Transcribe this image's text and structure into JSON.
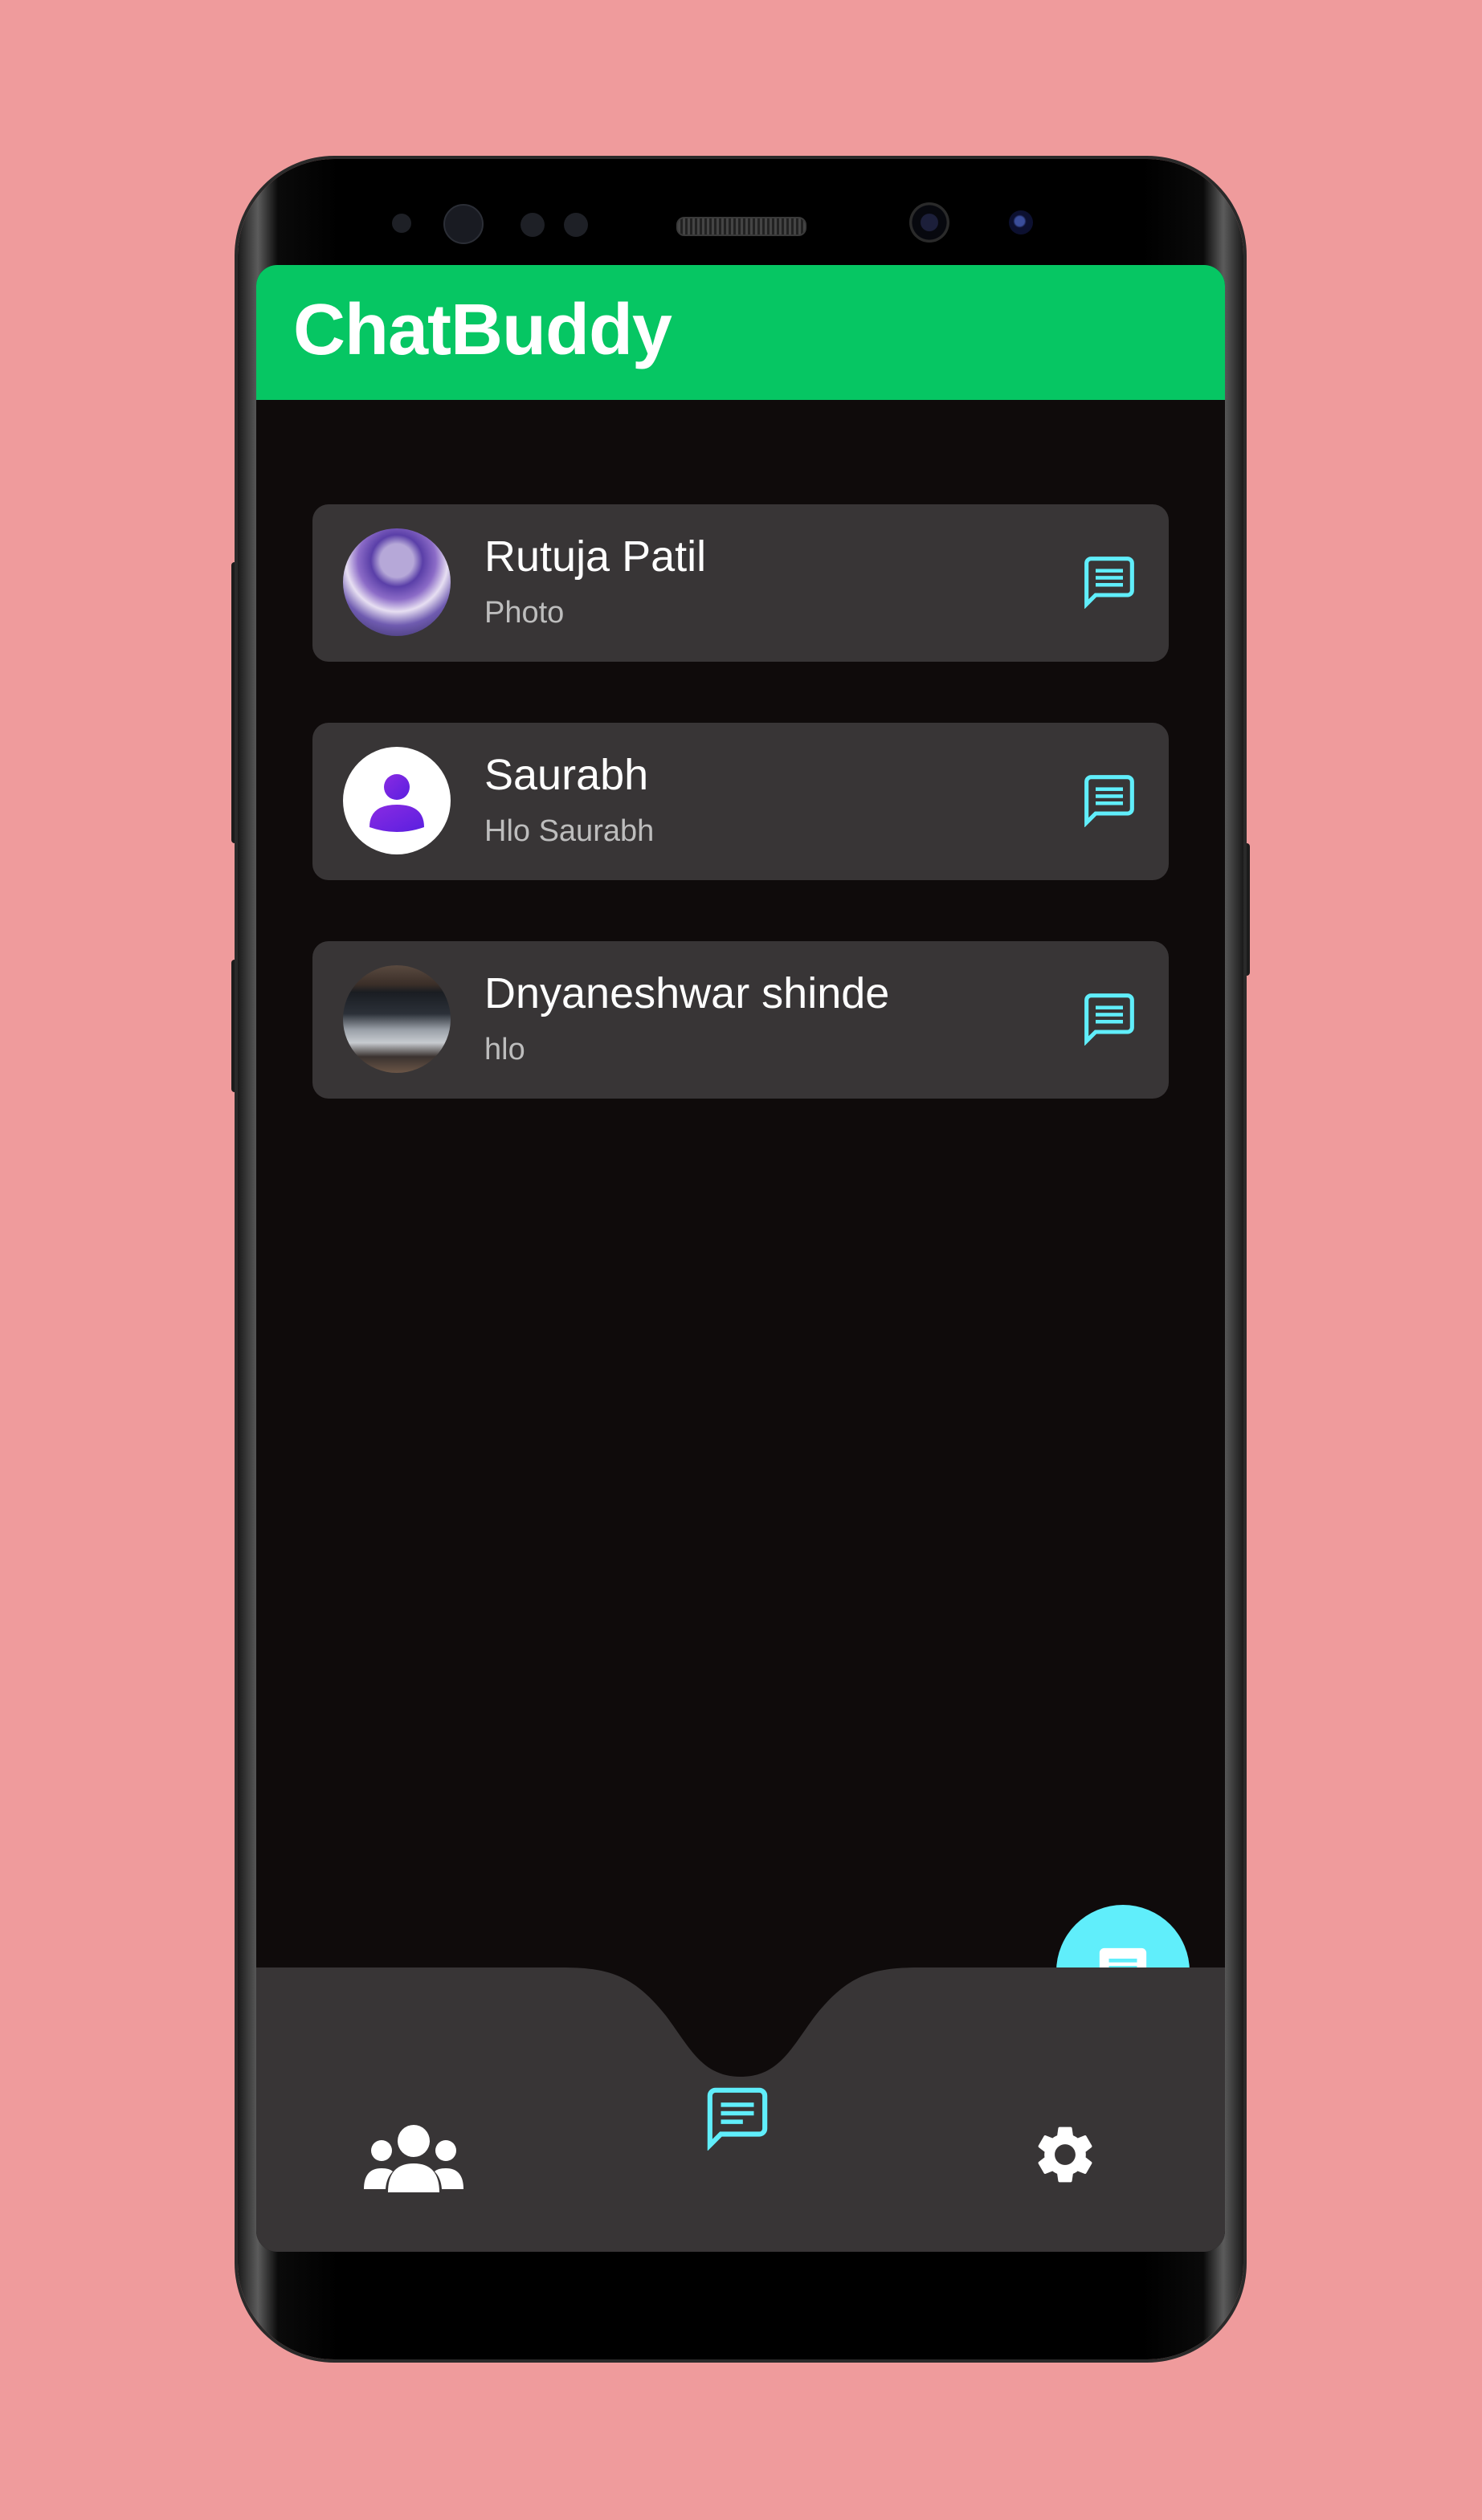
{
  "app": {
    "title": "ChatBuddy",
    "accent_color": "#06C663",
    "icon_color": "#60EEFB"
  },
  "chats": [
    {
      "name": "Rutuja Patil",
      "last_message": "Photo",
      "avatar": "anime-portrait"
    },
    {
      "name": "Saurabh",
      "last_message": "Hlo Saurabh",
      "avatar": "default-user-icon"
    },
    {
      "name": "Dnyaneshwar shinde",
      "last_message": "hlo",
      "avatar": "laptop-photo"
    }
  ],
  "icons": {
    "chat_item": "message-icon",
    "fab": "new-chat-icon",
    "nav_left": "users-icon",
    "nav_center": "chats-icon",
    "nav_right": "settings-gear-icon"
  },
  "bottom_nav": {
    "active_tab": "chats"
  }
}
